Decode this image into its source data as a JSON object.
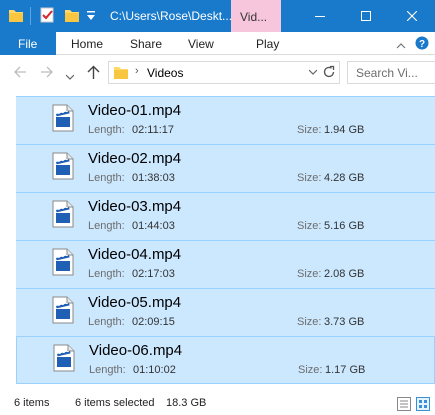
{
  "window": {
    "title": "C:\\Users\\Rose\\Deskt...",
    "context_tab": "Vid..."
  },
  "ribbon": {
    "file": "File",
    "tabs": [
      "Home",
      "Share",
      "View",
      "Play"
    ]
  },
  "address": {
    "path": "Videos",
    "search_placeholder": "Search Vi..."
  },
  "files": [
    {
      "name": "Video-01.mp4",
      "length_label": "Length:",
      "length": "02:11:17",
      "size_label": "Size:",
      "size": "1.94 GB"
    },
    {
      "name": "Video-02.mp4",
      "length_label": "Length:",
      "length": "01:38:03",
      "size_label": "Size:",
      "size": "4.28 GB"
    },
    {
      "name": "Video-03.mp4",
      "length_label": "Length:",
      "length": "01:44:03",
      "size_label": "Size:",
      "size": "5.16 GB"
    },
    {
      "name": "Video-04.mp4",
      "length_label": "Length:",
      "length": "02:17:03",
      "size_label": "Size:",
      "size": "2.08 GB"
    },
    {
      "name": "Video-05.mp4",
      "length_label": "Length:",
      "length": "02:09:15",
      "size_label": "Size:",
      "size": "3.73 GB"
    },
    {
      "name": "Video-06.mp4",
      "length_label": "Length:",
      "length": "01:10:02",
      "size_label": "Size:",
      "size": "1.17 GB"
    }
  ],
  "status": {
    "count": "6 items",
    "selected": "6 items selected",
    "selected_size": "18.3 GB"
  },
  "colors": {
    "title_bar": "#1979ca",
    "context_tab": "#f7c6dc",
    "selection_fill": "#cce8ff",
    "selection_border": "#99d1ff"
  },
  "icons": [
    "folder-icon",
    "properties-check-icon",
    "new-folder-icon",
    "customize-qat-icon",
    "minimize-icon",
    "maximize-icon",
    "close-icon",
    "collapse-ribbon-icon",
    "help-icon",
    "back-arrow-icon",
    "forward-arrow-icon",
    "recent-locations-icon",
    "up-arrow-icon",
    "refresh-icon",
    "video-file-icon",
    "details-view-icon",
    "large-icons-view-icon"
  ]
}
